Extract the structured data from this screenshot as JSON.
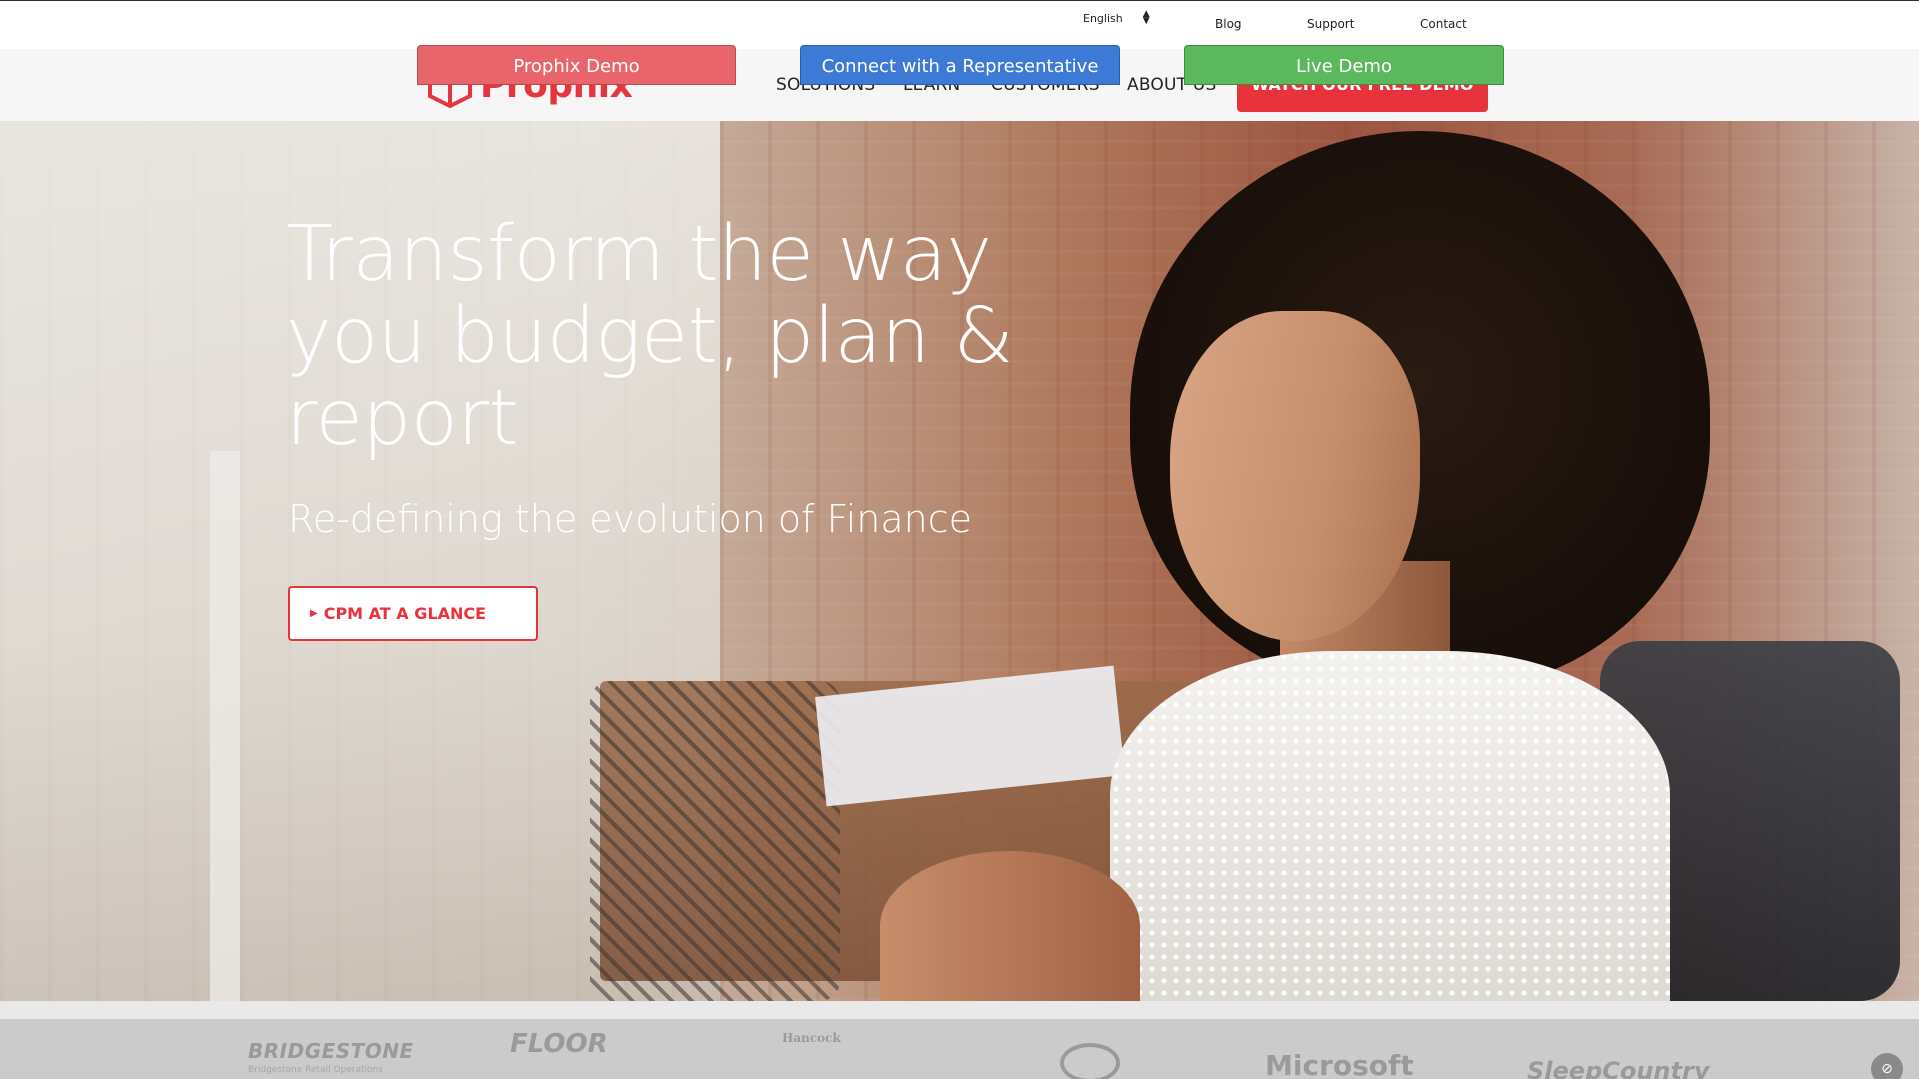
{
  "utility_bar": {
    "language": "English",
    "links": [
      "Blog",
      "Support",
      "Contact"
    ]
  },
  "brand": {
    "name": "Prophix",
    "reg_mark": "®",
    "color": "#e6353f"
  },
  "nav": {
    "items": [
      "SOLUTIONS",
      "LEARN",
      "CUSTOMERS",
      "ABOUT US"
    ],
    "cta": "WATCH OUR FREE DEMO"
  },
  "hero": {
    "title": "Transform the way you budget, plan & report",
    "subtitle": "Re-defining the evolution of Finance",
    "cta": "CPM AT A GLANCE",
    "cta_icon": "caret-right-icon"
  },
  "client_logos": {
    "bridgestone": "BRIDGESTONE",
    "bridgestone_sub": "Bridgestone Retail Operations",
    "floor": "FLOOR",
    "hancock": "Hancock",
    "microsoft": "Microsoft",
    "sleep_country": "SleepCountry"
  },
  "demo_buttons": [
    "Prophix Demo",
    "Connect with a Representative",
    "Live Demo"
  ],
  "colors": {
    "accent": "#e8323c",
    "blue": "#3c7ad6",
    "green": "#5bb85d"
  }
}
